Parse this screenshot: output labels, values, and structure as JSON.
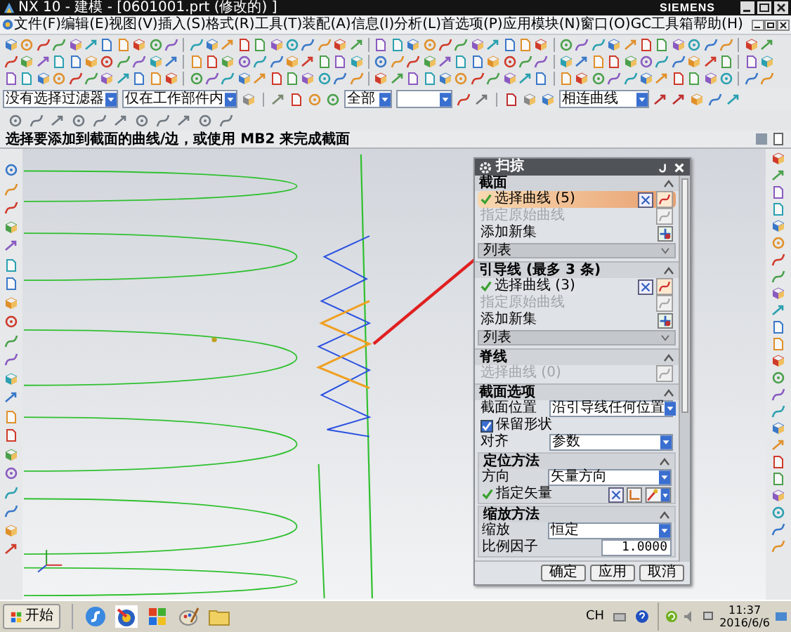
{
  "window": {
    "title": "NX 10 - 建模 - [0601001.prt (修改的) ]",
    "brand": "SIEMENS"
  },
  "menu": [
    "文件(F)",
    "编辑(E)",
    "视图(V)",
    "插入(S)",
    "格式(R)",
    "工具(T)",
    "装配(A)",
    "信息(I)",
    "分析(L)",
    "首选项(P)",
    "应用模块(N)",
    "窗口(O)",
    "GC工具箱",
    "帮助(H)"
  ],
  "filter_bar": {
    "type_filter": "没有选择过滤器",
    "scope": "仅在工作部件内",
    "layer": "全部",
    "curve_rule": "相连曲线"
  },
  "cue_line": "选择要添加到截面的曲线/边，或使用 MB2 来完成截面",
  "dialog": {
    "title": "扫掠",
    "sections": [
      {
        "title": "截面",
        "expanded": true,
        "rows": [
          {
            "kind": "select",
            "label": "选择曲线 (5)",
            "done": true,
            "selected": true,
            "disabled": false
          },
          {
            "kind": "select",
            "label": "指定原始曲线",
            "done": false,
            "selected": false,
            "disabled": true
          },
          {
            "kind": "add_set",
            "label": "添加新集"
          },
          {
            "kind": "list",
            "value": "列表"
          }
        ]
      },
      {
        "title": "引导线 (最多 3 条)",
        "expanded": true,
        "rows": [
          {
            "kind": "select",
            "label": "选择曲线 (3)",
            "done": true,
            "selected": false,
            "disabled": false
          },
          {
            "kind": "select",
            "label": "指定原始曲线",
            "done": false,
            "selected": false,
            "disabled": true
          },
          {
            "kind": "add_set",
            "label": "添加新集"
          },
          {
            "kind": "list",
            "value": "列表"
          }
        ]
      },
      {
        "title": "脊线",
        "expanded": true,
        "rows": [
          {
            "kind": "select",
            "label": "选择曲线 (0)",
            "done": false,
            "selected": false,
            "disabled": true
          }
        ]
      },
      {
        "title": "截面选项",
        "expanded": true,
        "rows": [
          {
            "kind": "dropdown",
            "label": "截面位置",
            "value": "沿引导线任何位置"
          },
          {
            "kind": "checkbox",
            "label": "保留形状",
            "checked": true
          },
          {
            "kind": "dropdown",
            "label": "对齐",
            "value": "参数"
          },
          {
            "kind": "subsection",
            "title": "定位方法",
            "expanded": true,
            "rows": [
              {
                "kind": "dropdown",
                "label": "方向",
                "value": "矢量方向"
              },
              {
                "kind": "vector",
                "label": "指定矢量",
                "done": true
              }
            ]
          },
          {
            "kind": "subsection",
            "title": "缩放方法",
            "expanded": true,
            "rows": [
              {
                "kind": "dropdown",
                "label": "缩放",
                "value": "恒定"
              },
              {
                "kind": "number",
                "label": "比例因子",
                "value": "1.0000"
              }
            ]
          }
        ]
      }
    ],
    "buttons": [
      "确定",
      "应用",
      "取消"
    ]
  },
  "taskbar": {
    "start": "开始",
    "language": "CH",
    "time": "11:37",
    "date": "2016/6/6"
  }
}
